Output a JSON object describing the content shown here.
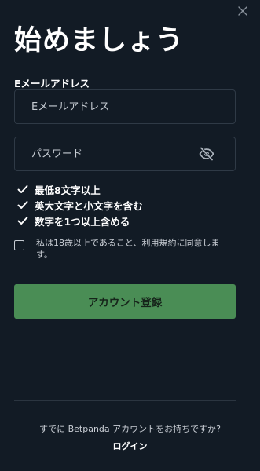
{
  "header": {
    "title": "始めましょう",
    "close_icon": "close-icon"
  },
  "email": {
    "label": "Eメールアドレス",
    "placeholder": "Eメールアドレス",
    "value": ""
  },
  "password": {
    "placeholder": "パスワード",
    "value": "",
    "toggle_icon": "eye-off-icon"
  },
  "rules": [
    {
      "label": "最低8文字以上",
      "icon": "check-icon"
    },
    {
      "label": "英大文字と小文字を含む",
      "icon": "check-icon"
    },
    {
      "label": "数字を1つ以上含める",
      "icon": "check-icon"
    }
  ],
  "consent": {
    "checked": false,
    "text": "私は18歳以上であること、利用規約に同意します。"
  },
  "register_button": {
    "label": "アカウント登録"
  },
  "footer": {
    "question": "すでに Betpanda アカウントをお持ちですか?",
    "login_label": "ログイン"
  },
  "colors": {
    "background": "#121b25",
    "input_border": "#2f3a46",
    "button": "#4a8d55",
    "button_text": "#16241a"
  }
}
